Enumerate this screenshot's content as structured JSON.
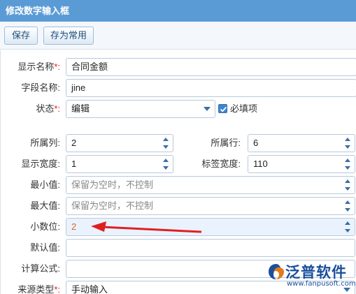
{
  "window": {
    "title": "修改数字输入框"
  },
  "toolbar": {
    "save_label": "保存",
    "save_common_label": "存为常用"
  },
  "form": {
    "display_name": {
      "label": "显示名称",
      "value": "合同金额"
    },
    "field_name": {
      "label": "字段名称:",
      "value": "jine"
    },
    "status": {
      "label": "状态",
      "value": "编辑",
      "required_label": "必填项",
      "required_checked": true
    },
    "column": {
      "label": "所属列:",
      "value": "2"
    },
    "row": {
      "label": "所属行:",
      "value": "6"
    },
    "display_width": {
      "label": "显示宽度:",
      "value": "1"
    },
    "label_width": {
      "label": "标签宽度:",
      "value": "110"
    },
    "min_value": {
      "label": "最小值:",
      "placeholder": "保留为空时，不控制"
    },
    "max_value": {
      "label": "最大值:",
      "placeholder": "保留为空时，不控制"
    },
    "decimals": {
      "label": "小数位:",
      "value": "2"
    },
    "default_value": {
      "label": "默认值:",
      "value": ""
    },
    "formula": {
      "label": "计算公式:",
      "value": ""
    },
    "source_type": {
      "label": "来源类型",
      "value": "手动输入"
    },
    "required_mark": "*:"
  },
  "watermark": {
    "text": "泛普软件",
    "url": "www.fanpusoft.com"
  },
  "colors": {
    "title_bg": "#5b9bd5",
    "accent": "#3a6ea5",
    "arrow": "#e02020",
    "highlight": "#eaf3fd"
  }
}
